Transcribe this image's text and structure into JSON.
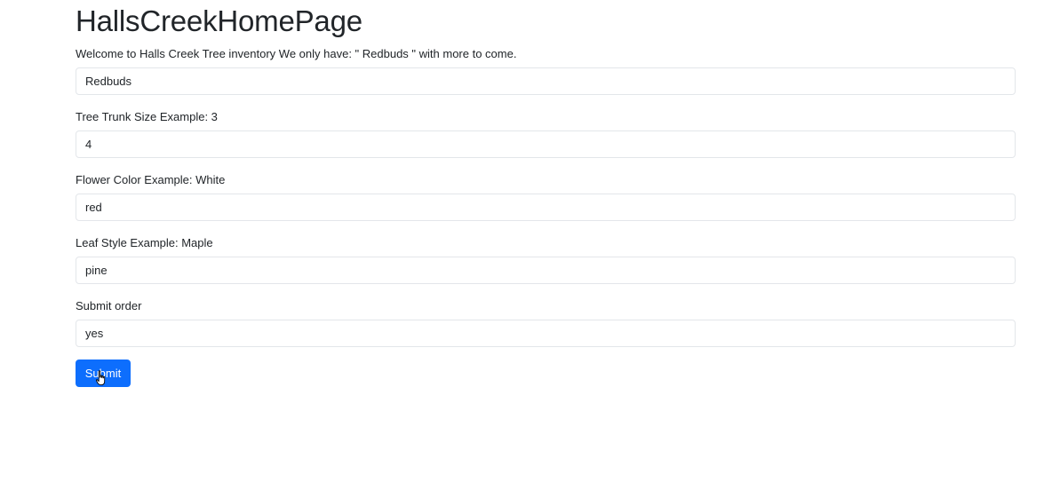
{
  "page": {
    "title": "HallsCreekHomePage",
    "intro": "Welcome to Halls Creek Tree inventory We only have: \" Redbuds \" with more to come."
  },
  "form": {
    "tree_type": {
      "value": "Redbuds"
    },
    "trunk_size": {
      "label": "Tree Trunk Size Example: 3",
      "value": "4"
    },
    "flower_color": {
      "label": "Flower Color Example: White",
      "value": "red"
    },
    "leaf_style": {
      "label": "Leaf Style Example: Maple",
      "value": "pine"
    },
    "submit_order": {
      "label": "Submit order",
      "value": "yes"
    },
    "submit_label": "Submit"
  },
  "colors": {
    "button_bg": "#0d6efd",
    "input_border": "#e3e6ea",
    "text": "#212529"
  },
  "icons": {
    "cursor": "hand-pointer-icon"
  }
}
